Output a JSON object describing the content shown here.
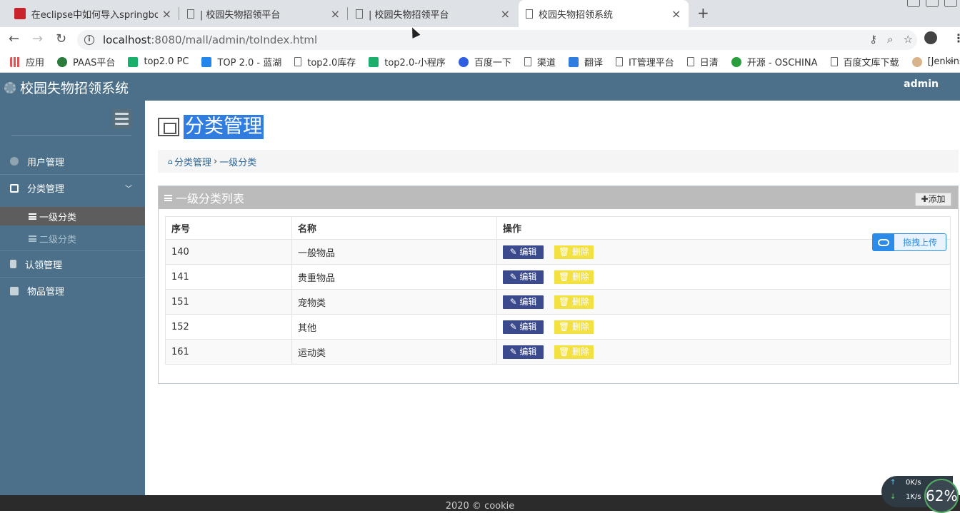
{
  "browser": {
    "tabs": [
      {
        "title": "在eclipse中如何导入springboot",
        "close": "×"
      },
      {
        "title": "| 校园失物招领平台",
        "close": "×"
      },
      {
        "title": "| 校园失物招领平台",
        "close": "×"
      },
      {
        "title": "校园失物招领系统",
        "close": "×"
      }
    ],
    "new_tab": "+",
    "url_host": "localhost",
    "url_rest": ":8080/mall/admin/toIndex.html",
    "bookmarks": [
      "应用",
      "PAAS平台",
      "top2.0 PC",
      "TOP 2.0 - 蓝湖",
      "top2.0库存",
      "top2.0-小程序",
      "百度一下",
      "渠道",
      "翻译",
      "IT管理平台",
      "日清",
      "开源 - OSCHINA",
      "百度文库下载",
      "[Jenkins]"
    ],
    "bookmark_more": "»"
  },
  "app": {
    "brand": "校园失物招领系统",
    "user": "admin",
    "sidebar": {
      "items": [
        {
          "label": "用户管理"
        },
        {
          "label": "分类管理"
        },
        {
          "label": "认领管理"
        },
        {
          "label": "物品管理"
        }
      ],
      "subitems": [
        {
          "label": "一级分类"
        },
        {
          "label": "二级分类"
        }
      ]
    },
    "page_title": "分类管理",
    "breadcrumb": {
      "home": "分类管理",
      "sep": "›",
      "current": "一级分类"
    },
    "panel": {
      "title": "一级分类列表",
      "add_label": "✚添加"
    },
    "table": {
      "headers": [
        "序号",
        "名称",
        "操作"
      ],
      "rows": [
        {
          "id": "140",
          "name": "一般物品"
        },
        {
          "id": "141",
          "name": "贵重物品"
        },
        {
          "id": "151",
          "name": "宠物类"
        },
        {
          "id": "152",
          "name": "其他"
        },
        {
          "id": "161",
          "name": "运动类"
        }
      ],
      "edit_label": "✎ 编辑",
      "delete_label": "🗑 删除"
    },
    "upload_widget": "拖拽上传",
    "footer": "2020 © cookie"
  },
  "net_monitor": {
    "up": "0K/s",
    "down": "1K/s",
    "percent": "62%"
  }
}
